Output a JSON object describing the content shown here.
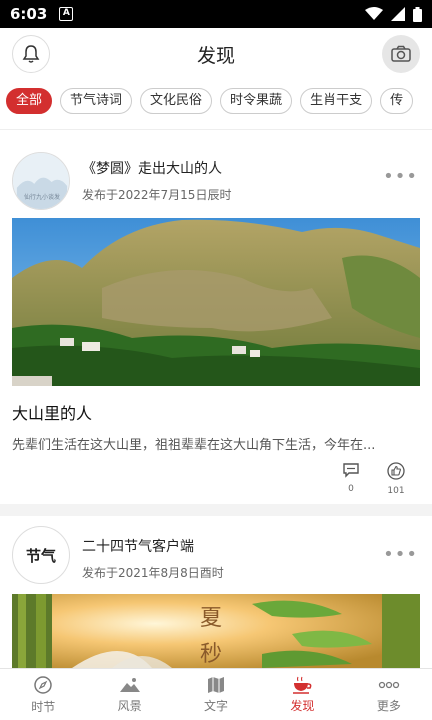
{
  "status_bar": {
    "time": "6:03",
    "notification_icon": "a-icon"
  },
  "header": {
    "title": "发现",
    "left_icon": "bell-icon",
    "right_icon": "camera-icon"
  },
  "tabs": [
    {
      "label": "全部",
      "active": true
    },
    {
      "label": "节气诗词"
    },
    {
      "label": "文化民俗"
    },
    {
      "label": "时令果蔬"
    },
    {
      "label": "生肖干支"
    },
    {
      "label": "传"
    }
  ],
  "posts": [
    {
      "author_title": "《梦圆》走出大山的人",
      "date": "发布于2022年7月15日辰时",
      "avatar_text": "仙行九小谈发",
      "headline": "大山里的人",
      "excerpt": "先辈们生活在这大山里，祖祖辈辈在这大山角下生活，今年在...",
      "comments": "0",
      "likes": "101"
    },
    {
      "author_title": "二十四节气客户端",
      "date": "发布于2021年8月8日酉时",
      "avatar_text": "节气",
      "image_text_1": "夏",
      "image_text_2": "秒"
    }
  ],
  "bottom_nav": [
    {
      "label": "时节",
      "icon": "compass-icon"
    },
    {
      "label": "风景",
      "icon": "landscape-icon"
    },
    {
      "label": "文字",
      "icon": "map-icon"
    },
    {
      "label": "发现",
      "icon": "teacup-icon",
      "active": true
    },
    {
      "label": "更多",
      "icon": "more-dots-icon"
    }
  ],
  "colors": {
    "accent": "#d32f2f"
  }
}
